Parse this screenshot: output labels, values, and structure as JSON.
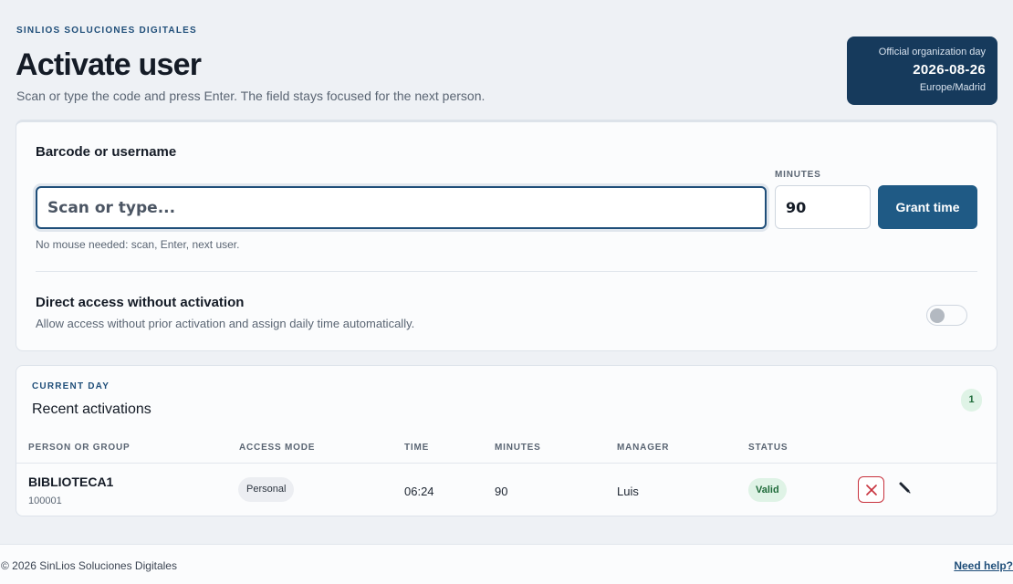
{
  "header": {
    "brand": "SINLIOS SOLUCIONES DIGITALES",
    "title": "Activate user",
    "subtitle": "Scan or type the code and press Enter. The field stays focused for the next person."
  },
  "org_day": {
    "label": "Official organization day",
    "date": "2026-08-26",
    "timezone": "Europe/Madrid"
  },
  "activate": {
    "field_title": "Barcode or username",
    "scan_placeholder": "Scan or type...",
    "scan_value": "",
    "minutes_label": "MINUTES",
    "minutes_value": "90",
    "grant_label": "Grant time",
    "hint": "No mouse needed: scan, Enter, next user.",
    "direct_title": "Direct access without activation",
    "direct_desc": "Allow access without prior activation and assign daily time automatically.",
    "direct_enabled": false
  },
  "recent": {
    "section_label": "CURRENT DAY",
    "title": "Recent activations",
    "count": "1",
    "columns": [
      "PERSON OR GROUP",
      "ACCESS MODE",
      "TIME",
      "MINUTES",
      "MANAGER",
      "STATUS"
    ],
    "rows": [
      {
        "person": "BIBLIOTECA1",
        "person_id": "100001",
        "access_mode": "Personal",
        "time": "06:24",
        "minutes": "90",
        "manager": "Luis",
        "status": "Valid"
      }
    ],
    "row_icons": [
      "close-icon",
      "pencil-icon"
    ]
  },
  "footer": {
    "copyright": "© 2026 SinLios Soluciones Digitales",
    "help": "Need help?"
  },
  "colors": {
    "accent": "#1f4e79",
    "button": "#1f5a85",
    "org_day_bg": "#163a5c",
    "valid": "#1f6b3a",
    "valid_bg": "#dff3e6",
    "danger": "#c8323d"
  }
}
